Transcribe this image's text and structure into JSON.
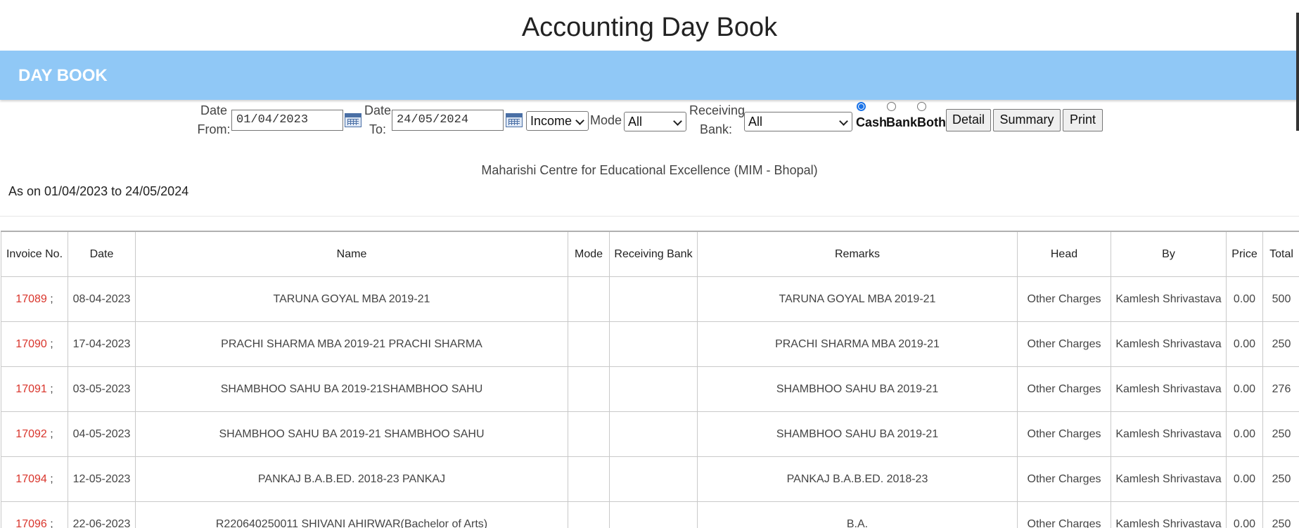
{
  "page": {
    "title": "Accounting Day Book"
  },
  "panel": {
    "title": "DAY BOOK"
  },
  "filters": {
    "date_from_label": "Date From:",
    "date_from_value": "01/04/2023",
    "date_to_label": "Date To:",
    "date_to_value": "24/05/2024",
    "type_value": "Income",
    "mode_label": "Mode",
    "mode_value": "All",
    "receiving_bank_label": "Receiving Bank:",
    "receiving_bank_value": "All",
    "radios": [
      {
        "label": "Cash",
        "checked": true
      },
      {
        "label": "Bank",
        "checked": false
      },
      {
        "label": "Both",
        "checked": false
      }
    ],
    "buttons": {
      "detail": "Detail",
      "summary": "Summary",
      "print": "Print"
    }
  },
  "report": {
    "organization": "Maharishi Centre for Educational Excellence (MIM - Bhopal)",
    "as_on": "As on 01/04/2023 to 24/05/2024"
  },
  "table": {
    "headers": [
      "Invoice No.",
      "Date",
      "Name",
      "Mode",
      "Receiving Bank",
      "Remarks",
      "Head",
      "By",
      "Price",
      "Total"
    ],
    "rows": [
      {
        "invoice": "17089",
        "date": "08-04-2023",
        "name": "TARUNA GOYAL MBA 2019-21",
        "mode": "",
        "bank": "",
        "remarks": "TARUNA GOYAL MBA 2019-21",
        "head": "Other Charges",
        "by": "Kamlesh Shrivastava",
        "price": "0.00",
        "total": "500"
      },
      {
        "invoice": "17090",
        "date": "17-04-2023",
        "name": "PRACHI SHARMA MBA 2019-21 PRACHI SHARMA",
        "mode": "",
        "bank": "",
        "remarks": "PRACHI SHARMA MBA 2019-21",
        "head": "Other Charges",
        "by": "Kamlesh Shrivastava",
        "price": "0.00",
        "total": "250"
      },
      {
        "invoice": "17091",
        "date": "03-05-2023",
        "name": "SHAMBHOO SAHU BA 2019-21SHAMBHOO SAHU",
        "mode": "",
        "bank": "",
        "remarks": "SHAMBHOO SAHU BA 2019-21",
        "head": "Other Charges",
        "by": "Kamlesh Shrivastava",
        "price": "0.00",
        "total": "276"
      },
      {
        "invoice": "17092",
        "date": "04-05-2023",
        "name": "SHAMBHOO SAHU BA 2019-21 SHAMBHOO SAHU",
        "mode": "",
        "bank": "",
        "remarks": "SHAMBHOO SAHU BA 2019-21",
        "head": "Other Charges",
        "by": "Kamlesh Shrivastava",
        "price": "0.00",
        "total": "250"
      },
      {
        "invoice": "17094",
        "date": "12-05-2023",
        "name": "PANKAJ B.A.B.ED. 2018-23 PANKAJ",
        "mode": "",
        "bank": "",
        "remarks": "PANKAJ B.A.B.ED. 2018-23",
        "head": "Other Charges",
        "by": "Kamlesh Shrivastava",
        "price": "0.00",
        "total": "250"
      },
      {
        "invoice": "17096",
        "date": "22-06-2023",
        "name": "R220640250011 SHIVANI AHIRWAR(Bachelor of Arts)",
        "mode": "",
        "bank": "",
        "remarks": "B.A.",
        "head": "Other Charges",
        "by": "Kamlesh Shrivastava",
        "price": "0.00",
        "total": "250"
      }
    ]
  }
}
